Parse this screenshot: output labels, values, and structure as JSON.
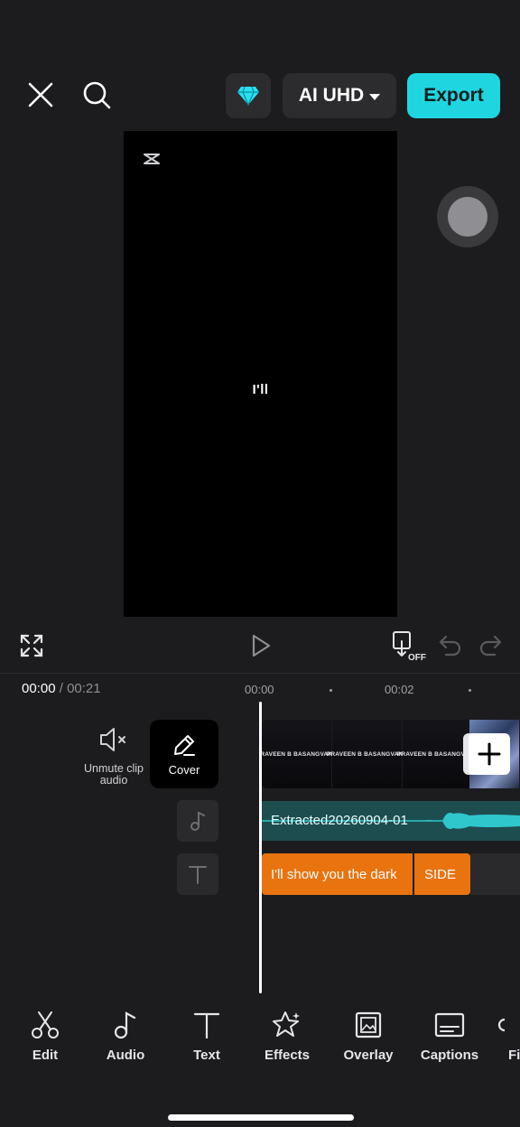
{
  "header": {
    "close_icon": "close-icon",
    "search_icon": "search-icon",
    "pro_icon": "diamond-icon",
    "resolution_label": "AI UHD",
    "export_label": "Export",
    "accent_color": "#1fd6e0"
  },
  "preview": {
    "caption_text": "I'll"
  },
  "controls": {
    "fullscreen_icon": "fullscreen-icon",
    "play_icon": "play-icon",
    "keyframe_off_label": "OFF",
    "undo_icon": "undo-icon",
    "redo_icon": "redo-icon"
  },
  "timeline": {
    "current_time": "00:00",
    "separator": "/",
    "total_time": "00:21",
    "ruler_labels": [
      "00:00",
      "00:02"
    ],
    "unmute_label": "Unmute clip audio",
    "cover_label": "Cover",
    "video_thumbnail_text": "PRAVEEN B BASANGVAKA",
    "audio_clip_label": "Extracted20260904-01",
    "text_clips": [
      "I'll show you the dark",
      "SIDE"
    ],
    "text_clip_color": "#e8730f",
    "audio_clip_color": "#1e4d4f"
  },
  "toolbar": {
    "items": [
      {
        "label": "Edit",
        "icon": "scissors-icon"
      },
      {
        "label": "Audio",
        "icon": "music-note-icon"
      },
      {
        "label": "Text",
        "icon": "text-icon"
      },
      {
        "label": "Effects",
        "icon": "effects-star-icon"
      },
      {
        "label": "Overlay",
        "icon": "overlay-icon"
      },
      {
        "label": "Captions",
        "icon": "captions-icon"
      },
      {
        "label": "Fi",
        "icon": "filters-icon"
      }
    ]
  }
}
